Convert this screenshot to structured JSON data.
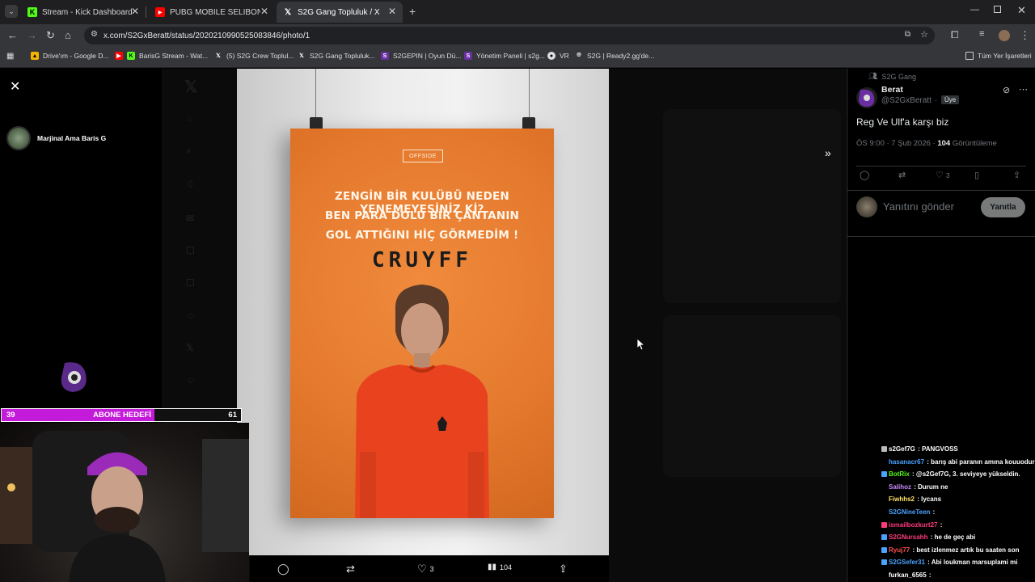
{
  "browser": {
    "tabs": [
      {
        "title": "Stream - Kick Dashboard",
        "favicon": "kick-icon",
        "color": "#53fc18"
      },
      {
        "title": "PUBG MOBİLE SELİBON LEAGU",
        "favicon": "youtube-icon",
        "color": "#ff0000"
      },
      {
        "title": "S2G Gang Topluluk / X",
        "favicon": "x-icon",
        "color": "#ffffff"
      }
    ],
    "url": "x.com/S2GxBeratt/status/2020210990525083846/photo/1",
    "bookmarks": [
      {
        "label": "Drive'ım - Google D..."
      },
      {
        "label": "BarisG Stream - Wat..."
      },
      {
        "label": "(5) S2G Crew Toplul..."
      },
      {
        "label": "S2G Gang Topluluk..."
      },
      {
        "label": "S2GEPIN | Oyun Dü..."
      },
      {
        "label": "Yönetim Paneli | s2g..."
      },
      {
        "label": "VR"
      },
      {
        "label": "S2G | Ready2.gg'de..."
      }
    ],
    "all_bookmarks": "Tüm Yer İşaretleri"
  },
  "stream": {
    "streamer_name": "Marjinal Ama Baris G",
    "sub_goal": {
      "current": "39",
      "label": "ABONE HEDEFİ",
      "target": "61",
      "progress": 0.64
    }
  },
  "poster": {
    "brand": "OFFSIDE",
    "quote_lines": [
      "ZENGİN BİR KULÜBÜ NEDEN YENEMEYESİNİZ Kİ?",
      "BEN PARA DOLU BİR ÇANTANIN",
      "GOL ATTIĞINI HİÇ GÖRMEDİM !"
    ],
    "name": "CRUYFF"
  },
  "photo_actions": {
    "likes": "3",
    "views": "104"
  },
  "tweet": {
    "community": "S2G Gang",
    "author_name": "Berat",
    "author_handle": "@S2GxBeratt",
    "role_badge": "Üye",
    "text": "Reg Ve Ulf'a karşı biz",
    "time": "ÖS 9:00 · 7 Şub 2026 · ",
    "views_count": "104",
    "views_label": " Görüntüleme",
    "likes": "3",
    "reply_placeholder": "Yanıtını gönder",
    "reply_button": "Yanıtla"
  },
  "chat": [
    {
      "user": "s2Gef7G",
      "color": "#ffffff",
      "text": "PANGVOSS"
    },
    {
      "user": "hasanacr67",
      "color": "#4aa3ff",
      "text": "barış abi paranın amına kouuodur bi"
    },
    {
      "user": "BotRix",
      "color": "#53fc18",
      "text": "@s2Gef7G, 3. seviyeye yükseldin."
    },
    {
      "user": "Salihoz",
      "color": "#c98bff",
      "text": "Durum ne"
    },
    {
      "user": "Fiwhhs2",
      "color": "#ffe066",
      "text": "lycans"
    },
    {
      "user": "S2GNineTeen",
      "color": "#4aa3ff",
      "text": ""
    },
    {
      "user": "ismailbozkurt27",
      "color": "#ff3b7f",
      "text": ""
    },
    {
      "user": "S2GNursahh",
      "color": "#ff3b7f",
      "text": "he de geç abi"
    },
    {
      "user": "Ryuj77",
      "color": "#ff4f4f",
      "text": "best izlenmez artık bu saaten son"
    },
    {
      "user": "S2GSefer31",
      "color": "#4aa3ff",
      "text": "Abi loukman marsuplami mi"
    },
    {
      "user": "furkan_6565",
      "color": "#ffffff",
      "text": ""
    }
  ]
}
